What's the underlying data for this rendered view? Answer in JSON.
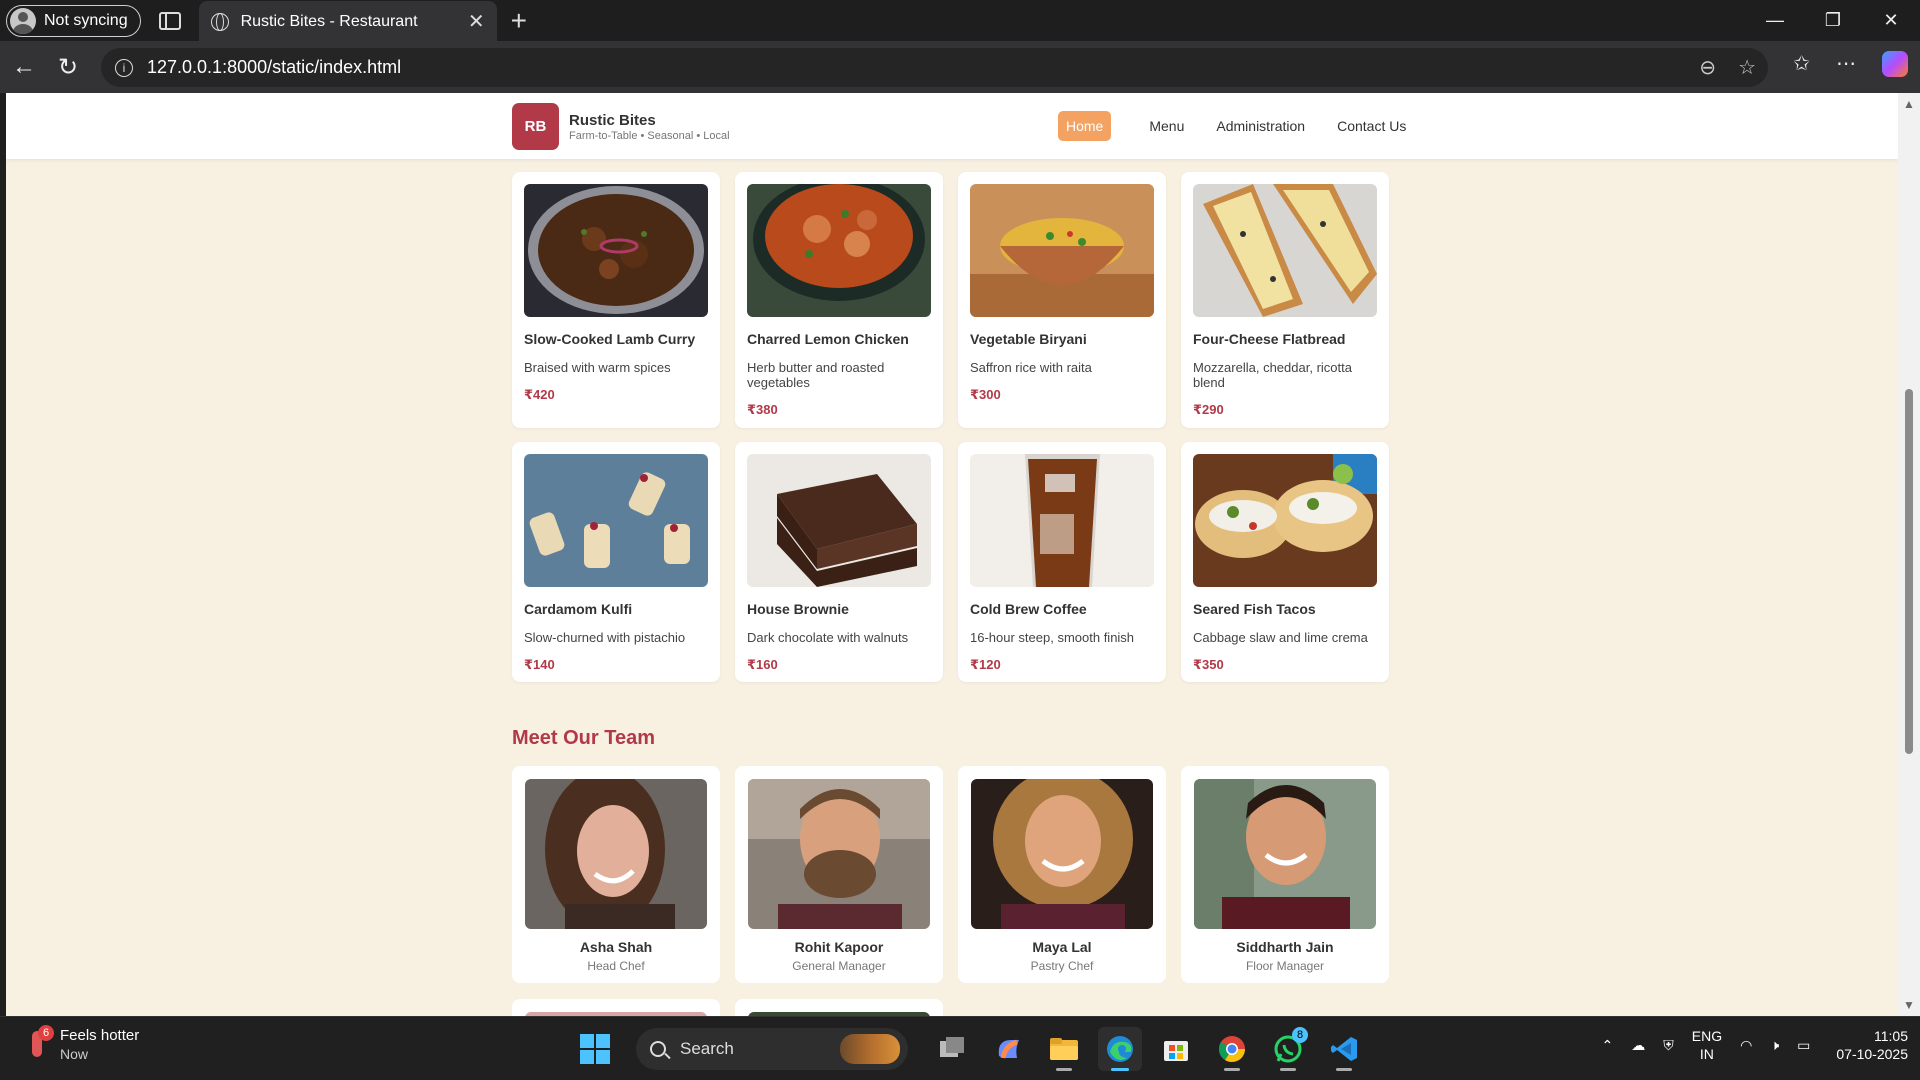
{
  "browser": {
    "profile_label": "Not syncing",
    "tab_title": "Rustic Bites - Restaurant",
    "url": "127.0.0.1:8000/static/index.html"
  },
  "site": {
    "logo_initials": "RB",
    "name": "Rustic Bites",
    "tagline": "Farm-to-Table • Seasonal • Local",
    "nav": [
      "Home",
      "Menu",
      "Administration",
      "Contact Us"
    ],
    "active_nav": "Home"
  },
  "menu_items": [
    {
      "name": "Slow-Cooked Lamb Curry",
      "desc": "Braised with warm spices",
      "price": "₹420"
    },
    {
      "name": "Charred Lemon Chicken",
      "desc": "Herb butter and roasted vegetables",
      "price": "₹380"
    },
    {
      "name": "Vegetable Biryani",
      "desc": "Saffron rice with raita",
      "price": "₹300"
    },
    {
      "name": "Four-Cheese Flatbread",
      "desc": "Mozzarella, cheddar, ricotta blend",
      "price": "₹290"
    },
    {
      "name": "Cardamom Kulfi",
      "desc": "Slow-churned with pistachio",
      "price": "₹140"
    },
    {
      "name": "House Brownie",
      "desc": "Dark chocolate with walnuts",
      "price": "₹160"
    },
    {
      "name": "Cold Brew Coffee",
      "desc": "16-hour steep, smooth finish",
      "price": "₹120"
    },
    {
      "name": "Seared Fish Tacos",
      "desc": "Cabbage slaw and lime crema",
      "price": "₹350"
    }
  ],
  "team_title": "Meet Our Team",
  "team": [
    {
      "name": "Asha Shah",
      "role": "Head Chef"
    },
    {
      "name": "Rohit Kapoor",
      "role": "General Manager"
    },
    {
      "name": "Maya Lal",
      "role": "Pastry Chef"
    },
    {
      "name": "Siddharth Jain",
      "role": "Floor Manager"
    }
  ],
  "taskbar": {
    "weather_title": "Feels hotter",
    "weather_sub": "Now",
    "weather_badge": "6",
    "search_label": "Search",
    "whatsapp_badge": "8",
    "lang_line1": "ENG",
    "lang_line2": "IN",
    "time": "11:05",
    "date": "07-10-2025"
  },
  "colors": {
    "accent": "#b23a48",
    "nav_active": "#f4a261",
    "page_bg": "#f8f0e1"
  }
}
